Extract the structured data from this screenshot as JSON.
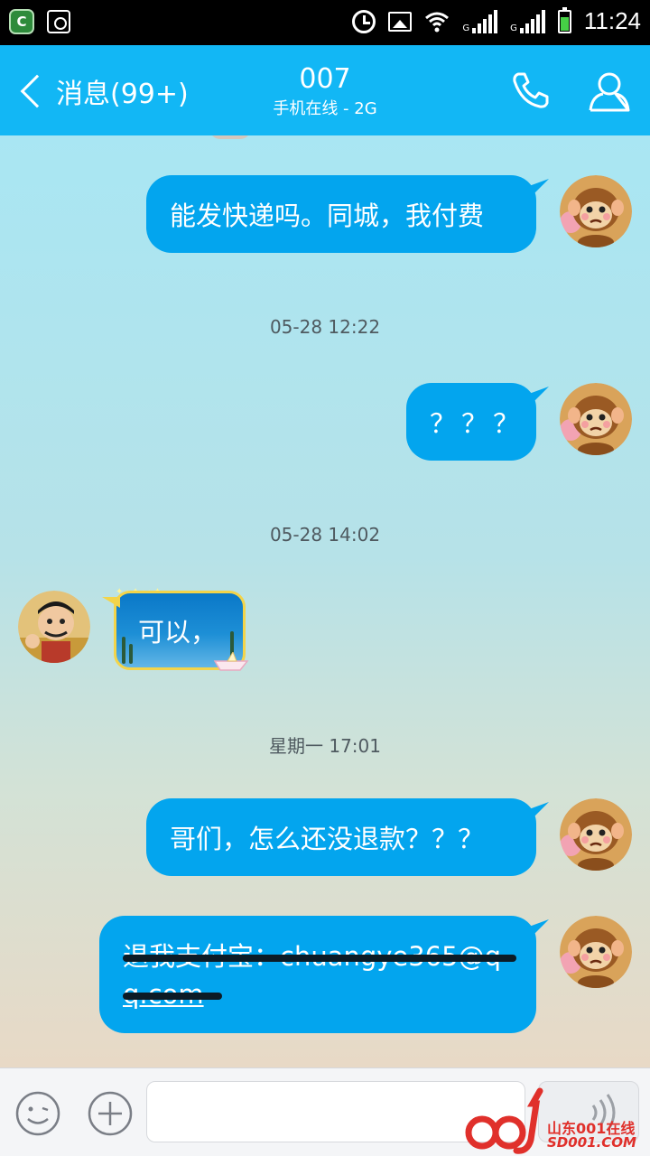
{
  "status_bar": {
    "time": "11:24",
    "network_label_1": "G",
    "network_label_2": "G",
    "icons": [
      "app-badge-icon",
      "screenshot-icon",
      "alarm-icon",
      "image-icon",
      "wifi-icon",
      "signal-icon",
      "signal-icon",
      "battery-icon"
    ]
  },
  "header": {
    "back_label": "消息(99+)",
    "title": "007",
    "subtitle": "手机在线 - 2G",
    "call_icon": "phone-icon",
    "profile_icon": "person-icon",
    "accent_color": "#12b7f5"
  },
  "messages": [
    {
      "direction": "out",
      "text": "能发快递吗。同城，我付费"
    },
    {
      "type": "timestamp",
      "text": "05-28 12:22"
    },
    {
      "direction": "out",
      "text": "？？？"
    },
    {
      "type": "timestamp",
      "text": "05-28 14:02"
    },
    {
      "direction": "in",
      "text": "可以，"
    },
    {
      "type": "timestamp",
      "text": "星期一 17:01"
    },
    {
      "direction": "out",
      "text": "哥们，怎么还没退款？？？"
    },
    {
      "direction": "out",
      "redacted": true,
      "line1": "退我支付宝：chuangye365@q",
      "line2": "q.com"
    }
  ],
  "input_bar": {
    "emoji_icon": "smiley-icon",
    "plus_icon": "plus-icon",
    "voice_icon": "voice-icon"
  },
  "watermark": {
    "brand": "山东001在线",
    "domain": "SD001.COM"
  },
  "colors": {
    "bubble_out": "#03a5ee",
    "timestamp_text": "#4f5a60"
  }
}
